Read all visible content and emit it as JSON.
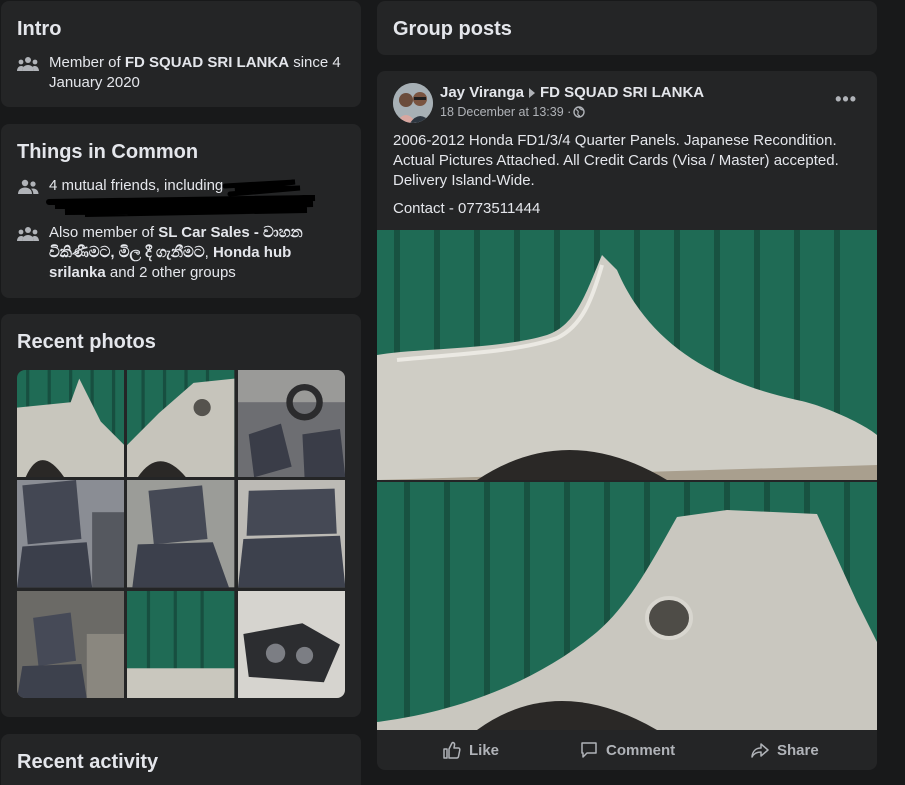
{
  "intro": {
    "title": "Intro",
    "member_prefix": "Member of ",
    "member_group": "FD SQUAD SRI LANKA",
    "member_suffix": " since 4 January 2020"
  },
  "common": {
    "title": "Things in Common",
    "mutual_text": "4 mutual friends, including",
    "also_prefix": "Also member of ",
    "group1": "SL Car Sales - වාහන විකිණීමට, මිල දී ගැනීමට",
    "sep": ", ",
    "group2": "Honda hub srilanka",
    "also_suffix": " and 2 other groups"
  },
  "recent_photos": {
    "title": "Recent photos"
  },
  "recent_activity": {
    "title": "Recent activity"
  },
  "group_posts": {
    "title": "Group posts"
  },
  "post": {
    "author": "Jay Viranga",
    "group": "FD SQUAD SRI LANKA",
    "timestamp": "18 December at 13:39 · ",
    "body": "2006-2012 Honda FD1/3/4 Quarter Panels. Japanese Recondition. Actual Pictures Attached. All Credit Cards (Visa / Master) accepted. Delivery Island-Wide.",
    "contact": "Contact - 0773511444",
    "more_label": "•••",
    "actions": {
      "like": "Like",
      "comment": "Comment",
      "share": "Share"
    }
  },
  "colors": {
    "background": "#18191a",
    "card": "#242526",
    "text_primary": "#e4e6eb",
    "text_secondary": "#b0b3b8",
    "wall_green": "#1f6b55"
  },
  "icons": [
    "members-icon",
    "friends-icon",
    "groups-icon",
    "globe-icon",
    "more-icon",
    "like-icon",
    "comment-icon",
    "share-icon"
  ]
}
